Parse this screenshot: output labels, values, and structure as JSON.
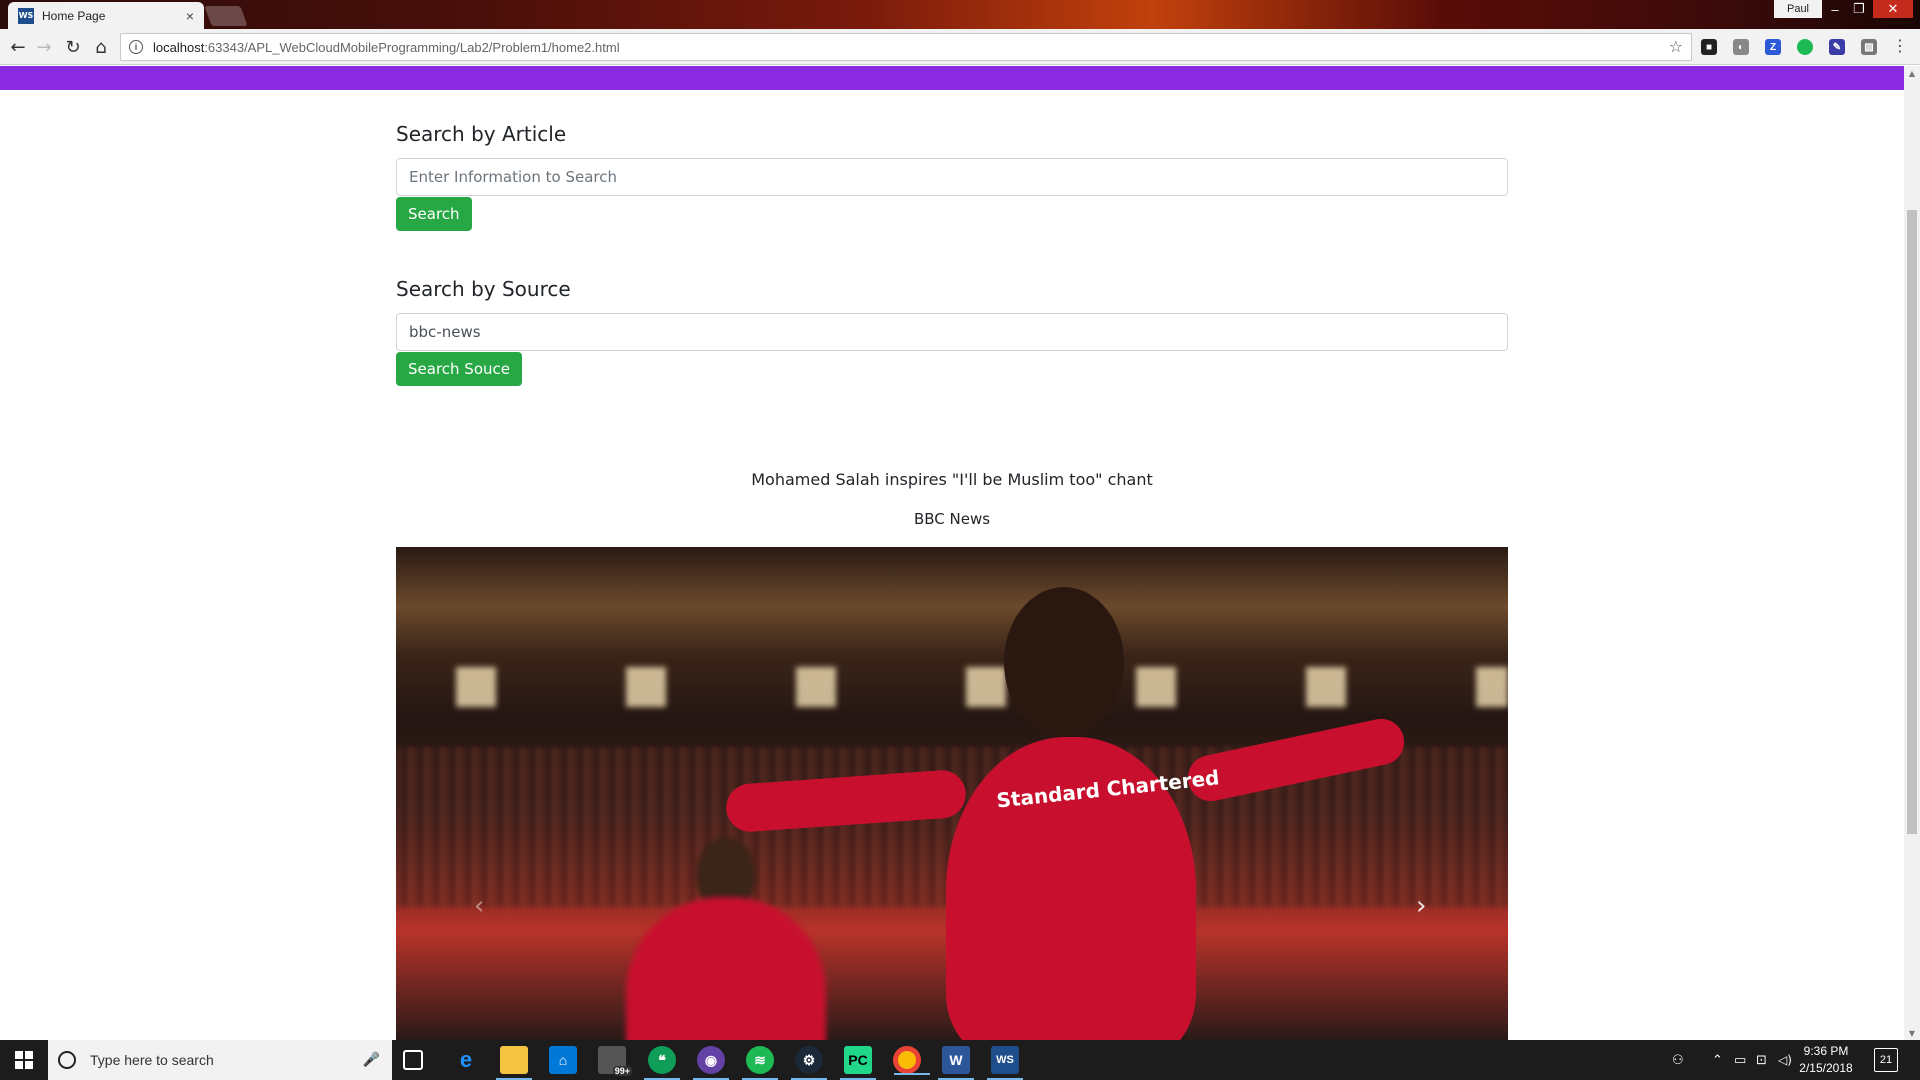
{
  "browser": {
    "tab_title": "Home Page",
    "tab_favicon": "WS",
    "tab_close": "×",
    "user_name": "Paul",
    "url_host": "localhost",
    "url_path": ":63343/APL_WebCloudMobileProgramming/Lab2/Problem1/home2.html"
  },
  "page": {
    "article_search": {
      "heading": "Search by Article",
      "placeholder": "Enter Information to Search",
      "button_label": "Search"
    },
    "source_search": {
      "heading": "Search by Source",
      "value": "bbc-news",
      "button_label": "Search Souce"
    },
    "article": {
      "title": "Mohamed Salah inspires \"I'll be Muslim too\" chant",
      "source": "BBC News",
      "image_sponsor": "Standard Chartered"
    }
  },
  "taskbar": {
    "search_placeholder": "Type here to search",
    "mail_badge": "99+",
    "time": "9:36 PM",
    "date": "2/15/2018",
    "notification_count": "21"
  },
  "colors": {
    "accent_purple": "#8a2be2",
    "button_green": "#28a745"
  }
}
